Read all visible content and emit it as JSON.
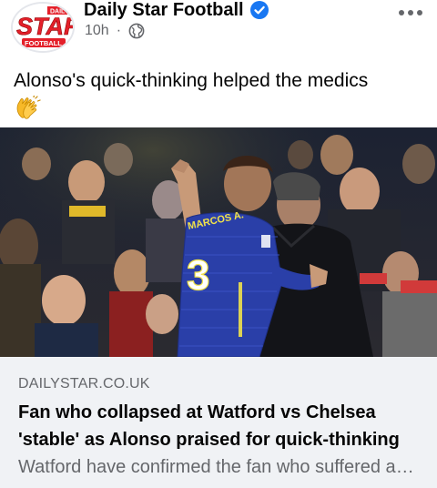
{
  "post": {
    "page_name": "Daily Star Football",
    "time": "10h",
    "separator": "·",
    "visibility_icon": "globe-icon",
    "verified_icon": "verified-badge-icon",
    "more_icon": "more-horizontal-icon",
    "logo": {
      "top_text": "DAILY",
      "main_text": "STAR",
      "bottom_text": "FOOTBALL"
    },
    "caption": "Alonso's quick-thinking helped the medics",
    "caption_emoji": "clapping-hands-emoji"
  },
  "photo": {
    "jersey_name": "MARCOS A.",
    "jersey_number": "3"
  },
  "link_preview": {
    "domain": "DAILYSTAR.CO.UK",
    "title": "Fan who collapsed at Watford vs Chelsea 'stable' as Alonso praised for quick-thinking",
    "description": "Watford have confirmed the fan who suffered a medical emergency is now stable"
  },
  "colors": {
    "brand_red": "#e4202a",
    "verified_blue": "#1877f2",
    "secondary_text": "#65676b",
    "link_box_bg": "#f0f2f5",
    "chelsea_blue": "#2a3fa8"
  }
}
